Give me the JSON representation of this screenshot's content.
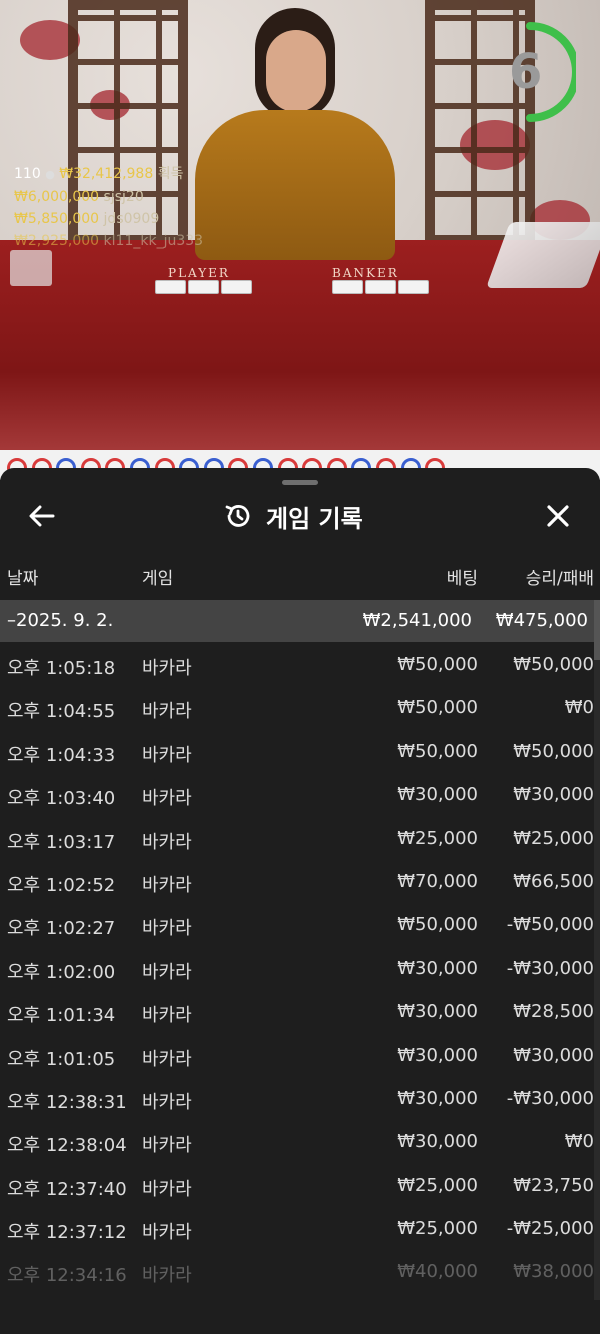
{
  "video": {
    "timer": "6",
    "table_labels": {
      "player": "PLAYER",
      "banker": "BANKER"
    },
    "bets": {
      "count": "110",
      "total": "₩32,412,988",
      "total_suffix": "획득",
      "winners": [
        {
          "amount": "₩6,000,000",
          "user": "sjsj20"
        },
        {
          "amount": "₩5,850,000",
          "user": "jds0909"
        },
        {
          "amount": "₩2,925,000",
          "user": "kl11_kk_ju333"
        }
      ]
    },
    "colors": {
      "timer_arc": "#3fbf4a",
      "amount": "#e8c64a"
    }
  },
  "road": {
    "beads": [
      "red",
      "red",
      "blue",
      "red",
      "red",
      "blue",
      "red",
      "blue",
      "blue",
      "red",
      "blue",
      "red",
      "red",
      "red",
      "blue",
      "red",
      "blue",
      "red"
    ],
    "colors": {
      "red": "#d83b3b",
      "blue": "#3a5fd0"
    }
  },
  "sheet": {
    "title": "게임 기록",
    "back_icon": "arrow-left-icon",
    "history_icon": "history-icon",
    "close_icon": "close-icon",
    "columns": {
      "date": "날짜",
      "game": "게임",
      "bet": "베팅",
      "win": "승리/패배"
    },
    "date_group": {
      "label": "–2025. 9. 2.",
      "bet": "₩2,541,000",
      "win": "₩475,000"
    },
    "rows": [
      {
        "time": "오후 1:05:18",
        "game": "바카라",
        "bet": "₩50,000",
        "win": "₩50,000"
      },
      {
        "time": "오후 1:04:55",
        "game": "바카라",
        "bet": "₩50,000",
        "win": "₩0"
      },
      {
        "time": "오후 1:04:33",
        "game": "바카라",
        "bet": "₩50,000",
        "win": "₩50,000"
      },
      {
        "time": "오후 1:03:40",
        "game": "바카라",
        "bet": "₩30,000",
        "win": "₩30,000"
      },
      {
        "time": "오후 1:03:17",
        "game": "바카라",
        "bet": "₩25,000",
        "win": "₩25,000"
      },
      {
        "time": "오후 1:02:52",
        "game": "바카라",
        "bet": "₩70,000",
        "win": "₩66,500"
      },
      {
        "time": "오후 1:02:27",
        "game": "바카라",
        "bet": "₩50,000",
        "win": "-₩50,000"
      },
      {
        "time": "오후 1:02:00",
        "game": "바카라",
        "bet": "₩30,000",
        "win": "-₩30,000"
      },
      {
        "time": "오후 1:01:34",
        "game": "바카라",
        "bet": "₩30,000",
        "win": "₩28,500"
      },
      {
        "time": "오후 1:01:05",
        "game": "바카라",
        "bet": "₩30,000",
        "win": "₩30,000"
      },
      {
        "time": "오후 12:38:31",
        "game": "바카라",
        "bet": "₩30,000",
        "win": "-₩30,000"
      },
      {
        "time": "오후 12:38:04",
        "game": "바카라",
        "bet": "₩30,000",
        "win": "₩0"
      },
      {
        "time": "오후 12:37:40",
        "game": "바카라",
        "bet": "₩25,000",
        "win": "₩23,750"
      },
      {
        "time": "오후 12:37:12",
        "game": "바카라",
        "bet": "₩25,000",
        "win": "-₩25,000"
      },
      {
        "time": "오후 12:34:16",
        "game": "바카라",
        "bet": "₩40,000",
        "win": "₩38,000"
      }
    ]
  }
}
